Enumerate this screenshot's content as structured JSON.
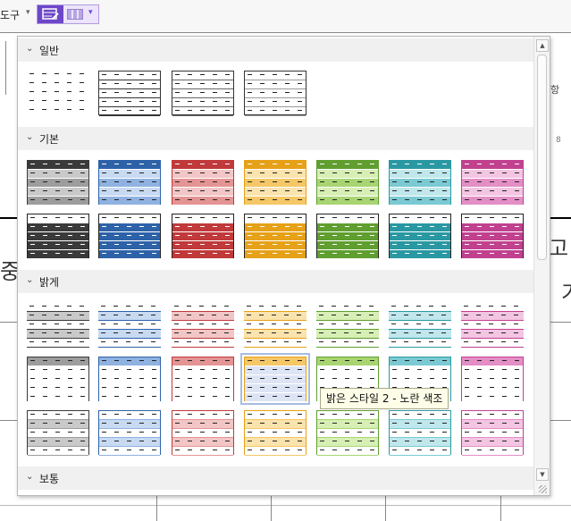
{
  "toolbar": {
    "label": "도구",
    "table_style_icon": "table-style-icon",
    "table_grid_icon": "table-grid-icon"
  },
  "document": {
    "left_char": "중",
    "right_char_1": "고",
    "right_char_2": "기",
    "right_icon_char": "항",
    "ruler_number": "8"
  },
  "gallery": {
    "sections": [
      {
        "title": "일반",
        "state": "expanded"
      },
      {
        "title": "기본",
        "state": "expanded"
      },
      {
        "title": "밝게",
        "state": "expanded"
      },
      {
        "title": "보통",
        "state": "expanded"
      }
    ],
    "palette": {
      "black": "#3a3a3a",
      "blue": "#2e62a8",
      "red": "#c0393b",
      "yellow": "#e6a118",
      "green": "#5f9e2f",
      "teal": "#2a98a2",
      "pink": "#c1418f"
    },
    "selected_style": "밝은 스타일 2 - 노란 색조"
  },
  "tooltip": {
    "text": "밝은 스타일 2 - 노란 색조"
  }
}
